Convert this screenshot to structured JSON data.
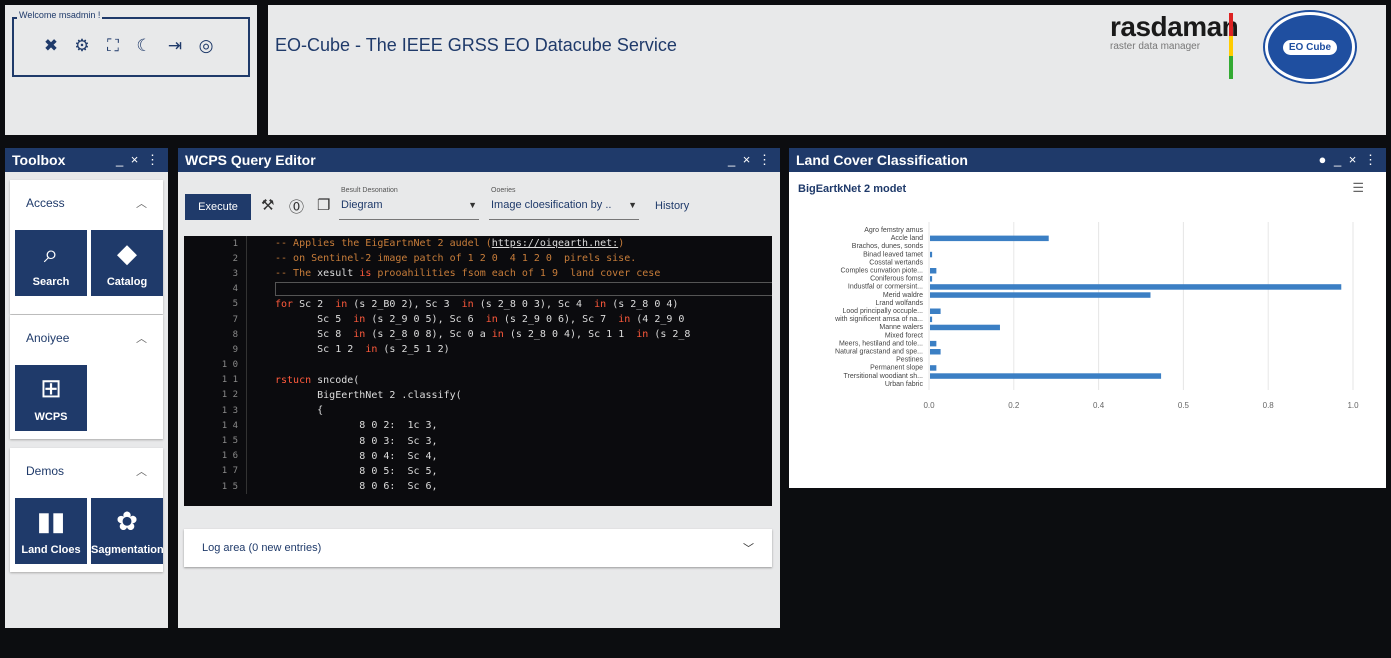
{
  "header": {
    "welcome": "Welcome msadmin !",
    "tool_icons": [
      "wrench-icon",
      "search-gear-icon",
      "fullscreen-icon",
      "moon-icon",
      "logout-icon",
      "help-circle-icon"
    ],
    "app_title": "EO-Cube  -  The IEEE GRSS EO Datacube Service",
    "logo_name": "rasdaman",
    "logo_sub": "raster data manager",
    "seal_text": "EO Cube"
  },
  "toolbox": {
    "title": "Toolbox",
    "controls": "_ × ⋮",
    "sections": [
      {
        "label": "Access",
        "tiles": [
          {
            "label": "Search",
            "icon": "search-icon"
          },
          {
            "label": "Catalog",
            "icon": "layers-icon"
          }
        ]
      },
      {
        "label": "Anoiyee",
        "tiles": [
          {
            "label": "WCPS",
            "icon": "chart-add-icon"
          }
        ]
      },
      {
        "label": "Demos",
        "tiles": [
          {
            "label": "Land Cloes",
            "icon": "bar-chart-icon"
          },
          {
            "label": "Sagmentation",
            "icon": "palette-icon"
          }
        ]
      }
    ]
  },
  "editor": {
    "title": "WCPS Query Editor",
    "controls": "_ × ⋮",
    "execute_label": "Execute",
    "result_caption": "Besult Desonation",
    "result_value": "Diegram",
    "queries_caption": "Ooeries",
    "queries_value": "Image cloesification by ..",
    "history_label": "History",
    "code_lines": [
      {
        "n": "1",
        "parts": [
          [
            "cm",
            "-- Applies the EigEartnNet 2 audel ("
          ],
          [
            "ul",
            "https://oiqearth.net:"
          ],
          [
            "cm",
            ")"
          ]
        ]
      },
      {
        "n": "2",
        "parts": [
          [
            "cm",
            "-- on Sentinel-2 image patch of 1 2 0  4 1 2 0  pirels sise."
          ]
        ]
      },
      {
        "n": "3",
        "parts": [
          [
            "cm",
            "-- The "
          ],
          [
            "tx",
            "xesult "
          ],
          [
            "kw",
            "is"
          ],
          [
            "cm",
            " prooahilities fsom each of 1 9  land cover cese"
          ]
        ]
      },
      {
        "n": "4",
        "parts": []
      },
      {
        "n": "5",
        "parts": [
          [
            "kw",
            "for"
          ],
          [
            "tx",
            " Sc 2  "
          ],
          [
            "kw",
            "in"
          ],
          [
            "tx",
            " (s 2_B0 2), Sc 3  "
          ],
          [
            "kw",
            "in"
          ],
          [
            "tx",
            " (s 2_8 0 3), Sc 4  "
          ],
          [
            "kw",
            "in"
          ],
          [
            "tx",
            " (s 2_8 0 4)"
          ]
        ]
      },
      {
        "n": "7",
        "parts": [
          [
            "tx",
            "       Sc 5  "
          ],
          [
            "kw",
            "in"
          ],
          [
            "tx",
            " (s 2_9 0 5), Sc 6  "
          ],
          [
            "kw",
            "in"
          ],
          [
            "tx",
            " (s 2_9 0 6), Sc 7  "
          ],
          [
            "kw",
            "in"
          ],
          [
            "tx",
            " (4 2_9 0"
          ]
        ]
      },
      {
        "n": "8",
        "parts": [
          [
            "tx",
            "       Sc 8  "
          ],
          [
            "kw",
            "in"
          ],
          [
            "tx",
            " (s 2_8 0 8), Sc 0 a "
          ],
          [
            "kw",
            "in"
          ],
          [
            "tx",
            " (s 2_8 0 4), Sc 1 1  "
          ],
          [
            "kw",
            "in"
          ],
          [
            "tx",
            " (s 2_8"
          ]
        ]
      },
      {
        "n": "9",
        "parts": [
          [
            "tx",
            "       Sc 1 2  "
          ],
          [
            "kw",
            "in"
          ],
          [
            "tx",
            " (s 2_5 1 2)"
          ]
        ]
      },
      {
        "n": "1 0",
        "parts": []
      },
      {
        "n": "1 1",
        "parts": [
          [
            "kw",
            "rstucn"
          ],
          [
            "tx",
            " sncode("
          ]
        ]
      },
      {
        "n": "1 2",
        "parts": [
          [
            "tx",
            "       BigEerthNet 2 .classify("
          ]
        ]
      },
      {
        "n": "1 3",
        "parts": [
          [
            "tx",
            "       {"
          ]
        ]
      },
      {
        "n": "1 4",
        "parts": [
          [
            "tx",
            "              8 0 2:  1c 3,"
          ]
        ]
      },
      {
        "n": "1 5",
        "parts": [
          [
            "tx",
            "              8 0 3:  Sc 3,"
          ]
        ]
      },
      {
        "n": "1 6",
        "parts": [
          [
            "tx",
            "              8 0 4:  Sc 4,"
          ]
        ]
      },
      {
        "n": "1 7",
        "parts": [
          [
            "tx",
            "              8 0 5:  Sc 5,"
          ]
        ]
      },
      {
        "n": "1 5",
        "parts": [
          [
            "tx",
            "              8 0 6:  Sc 6,"
          ]
        ]
      }
    ],
    "log_label": "Log area (0 new entries)"
  },
  "landcover": {
    "title": "Land Cover Classification",
    "controls": "● _ × ⋮",
    "chart_data": {
      "type": "bar",
      "orientation": "horizontal",
      "title": "BigEartkNet 2 modet",
      "categories": [
        "Agro femstry amus",
        "Accle land",
        "Brachos, dunes, sonds",
        "Binad leaved tamet",
        "Cosstal wertands",
        "Comples cunvation piote...",
        "Coniferous fomst",
        "Industfal or cormersint...",
        "Merid waldre",
        "Lrand wolfands",
        "Lood principally occuple...",
        "with significent amsa of na...",
        "Manne walers",
        "Mixed forect",
        "Meers, hestiland and tole...",
        "Natural gracstand and spe...",
        "Pestines",
        "Permanent slope",
        "Trersitional woodiant sh...",
        "Urban fabric"
      ],
      "values": [
        0.0,
        0.28,
        0.0,
        0.005,
        0.0,
        0.015,
        0.005,
        0.97,
        0.52,
        0.0,
        0.025,
        0.005,
        0.165,
        0.0,
        0.015,
        0.025,
        0.0,
        0.015,
        0.545,
        0.0
      ],
      "xlim": [
        0,
        1.0
      ],
      "tick_labels": [
        "0.0",
        "0.2",
        "0.4",
        "0.5",
        "0.8",
        "1.0"
      ],
      "bar_color": "#3b7fc4",
      "grid": true
    }
  }
}
